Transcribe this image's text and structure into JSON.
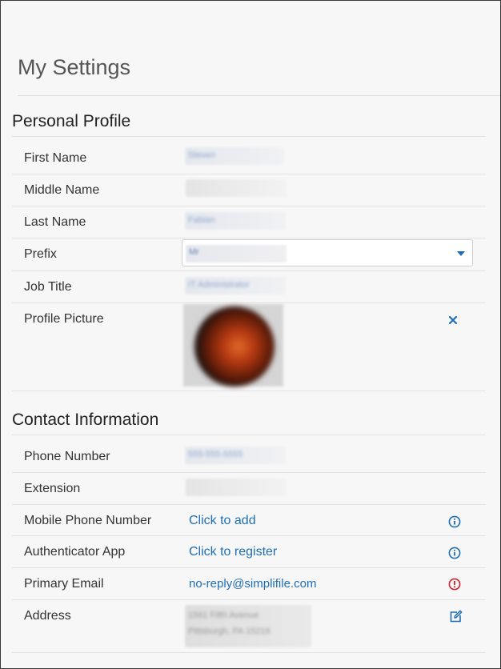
{
  "page": {
    "title": "My Settings"
  },
  "personal_profile": {
    "heading": "Personal Profile",
    "fields": {
      "first_name": {
        "label": "First Name",
        "value": "Steven"
      },
      "middle_name": {
        "label": "Middle Name",
        "value": ""
      },
      "last_name": {
        "label": "Last Name",
        "value": "Fabian"
      },
      "prefix": {
        "label": "Prefix",
        "value": "Mr"
      },
      "job_title": {
        "label": "Job Title",
        "value": "IT Administrator"
      },
      "profile_picture": {
        "label": "Profile Picture"
      }
    },
    "remove_picture_icon": "close-icon"
  },
  "contact_information": {
    "heading": "Contact Information",
    "fields": {
      "phone_number": {
        "label": "Phone Number",
        "value": "555-555-5555"
      },
      "extension": {
        "label": "Extension",
        "value": ""
      },
      "mobile_phone": {
        "label": "Mobile Phone Number",
        "action": "Click to add",
        "icon": "info-icon"
      },
      "authenticator_app": {
        "label": "Authenticator App",
        "action": "Click to register",
        "icon": "info-icon"
      },
      "primary_email": {
        "label": "Primary Email",
        "value": "no-reply@simplifile.com",
        "icon": "alert-icon"
      },
      "address": {
        "label": "Address",
        "line1": "1561 Fifth Avenue",
        "line2": "Pittsburgh, PA 15219",
        "icon": "edit-icon"
      }
    }
  },
  "colors": {
    "link": "#1f6db3",
    "alert": "#d0202b",
    "background": "#f7f7f7"
  }
}
